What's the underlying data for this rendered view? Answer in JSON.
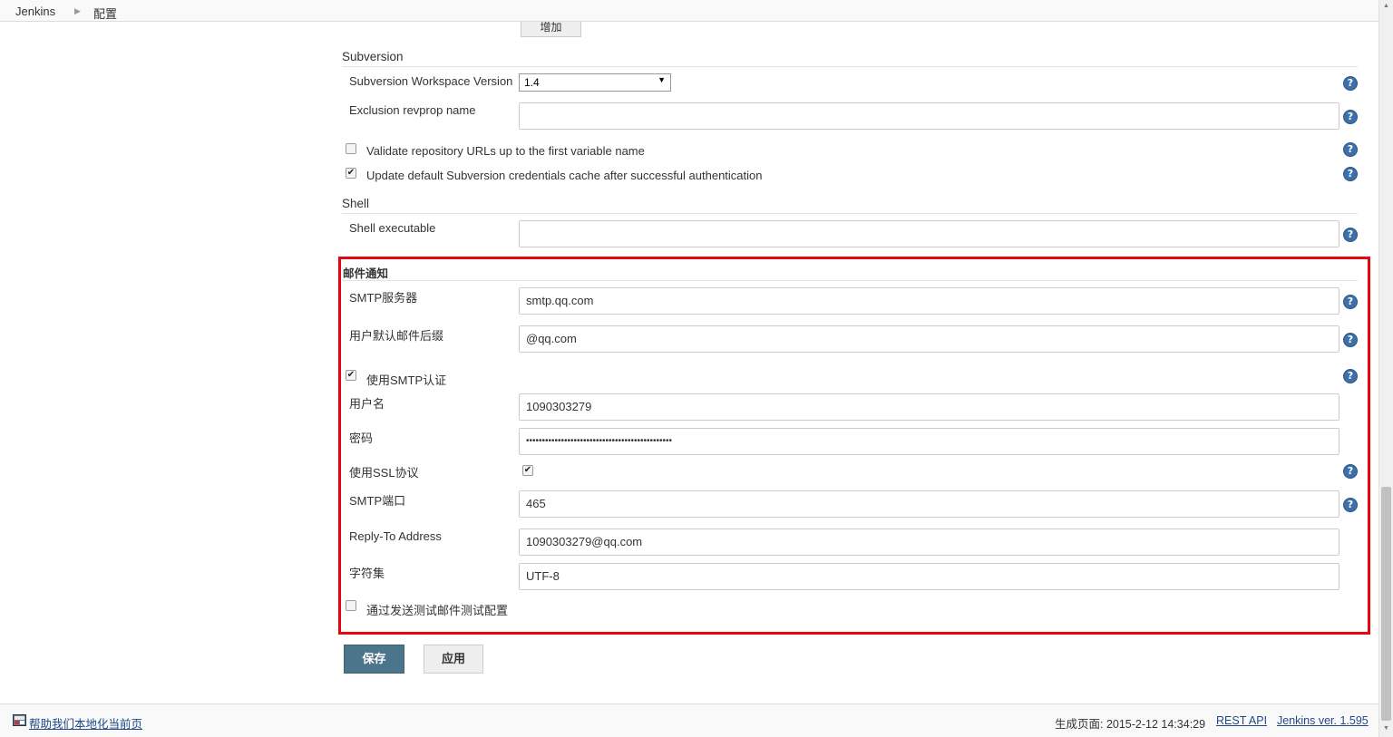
{
  "breadcrumb": {
    "home": "Jenkins",
    "current": "配置"
  },
  "add_button": "增加",
  "subversion": {
    "title": "Subversion",
    "workspace_label": "Subversion Workspace Version",
    "workspace_value": "1.4",
    "exclusion_label": "Exclusion revprop name",
    "exclusion_value": "",
    "validate_label": "Validate repository URLs up to the first variable name",
    "validate_checked": false,
    "update_label": "Update default Subversion credentials cache after successful authentication",
    "update_checked": true
  },
  "shell": {
    "title": "Shell",
    "exe_label": "Shell executable",
    "exe_value": ""
  },
  "mail": {
    "title": "邮件通知",
    "smtp_label": "SMTP服务器",
    "smtp_value": "smtp.qq.com",
    "suffix_label": "用户默认邮件后缀",
    "suffix_value": "@qq.com",
    "auth_label": "使用SMTP认证",
    "auth_checked": true,
    "user_label": "用户名",
    "user_value": "1090303279",
    "pass_label": "密码",
    "pass_value": "••••••••••••••••••••••••••••••••••••••••••••••",
    "ssl_label": "使用SSL协议",
    "ssl_checked": true,
    "port_label": "SMTP端口",
    "port_value": "465",
    "reply_label": "Reply-To Address",
    "reply_value": "1090303279@qq.com",
    "charset_label": "字符集",
    "charset_value": "UTF-8",
    "test_label": "通过发送测试邮件测试配置",
    "test_checked": false
  },
  "buttons": {
    "save": "保存",
    "apply": "应用"
  },
  "footer": {
    "localize_link": "帮助我们本地化当前页",
    "generated": "生成页面: 2015-2-12 14:34:29",
    "rest_api": "REST API",
    "version": "Jenkins ver. 1.595"
  },
  "icons": {
    "help": "help-icon",
    "checkmark": "✔"
  },
  "colors": {
    "highlight_border": "#e30613",
    "save_button": "#4b758b",
    "help_icon": "#3d6fa8"
  }
}
